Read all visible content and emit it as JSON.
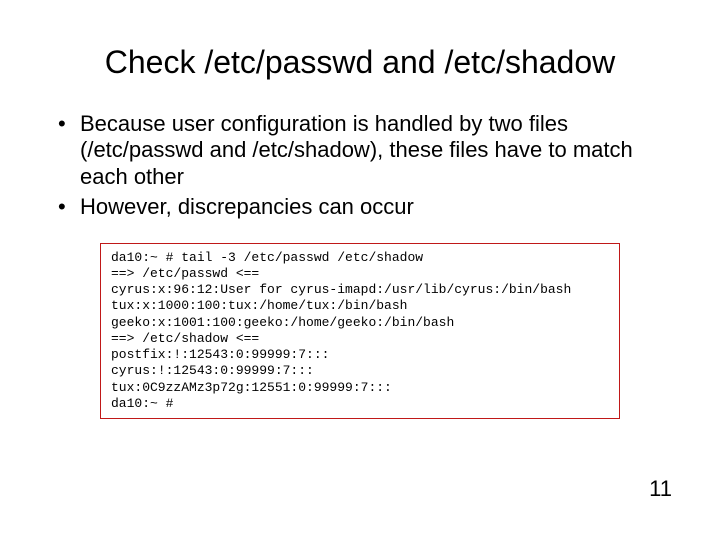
{
  "title": "Check /etc/passwd and /etc/shadow",
  "bullets": [
    "Because user configuration is handled by two files (/etc/passwd and /etc/shadow), these files have to match each other",
    "However, discrepancies can occur"
  ],
  "terminal_lines": [
    "da10:~ # tail -3 /etc/passwd /etc/shadow",
    "==> /etc/passwd <==",
    "cyrus:x:96:12:User for cyrus-imapd:/usr/lib/cyrus:/bin/bash",
    "tux:x:1000:100:tux:/home/tux:/bin/bash",
    "geeko:x:1001:100:geeko:/home/geeko:/bin/bash",
    "==> /etc/shadow <==",
    "postfix:!:12543:0:99999:7:::",
    "cyrus:!:12543:0:99999:7:::",
    "tux:0C9zzAMz3p72g:12551:0:99999:7:::",
    "da10:~ #"
  ],
  "page_number": "11"
}
